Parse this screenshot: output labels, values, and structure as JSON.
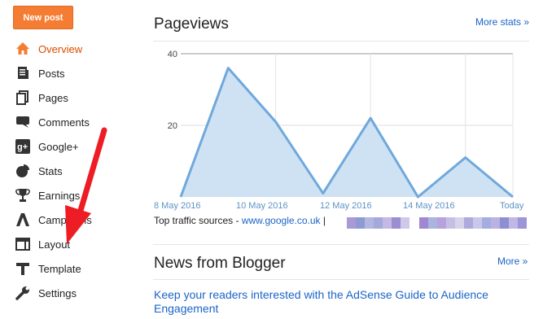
{
  "sidebar": {
    "new_post_label": "New post",
    "items": [
      {
        "label": "Overview",
        "icon": "home-icon",
        "active": true
      },
      {
        "label": "Posts",
        "icon": "posts-icon"
      },
      {
        "label": "Pages",
        "icon": "pages-icon"
      },
      {
        "label": "Comments",
        "icon": "comments-icon"
      },
      {
        "label": "Google+",
        "icon": "google-plus-icon"
      },
      {
        "label": "Stats",
        "icon": "stats-icon"
      },
      {
        "label": "Earnings",
        "icon": "trophy-icon"
      },
      {
        "label": "Campaigns",
        "icon": "campaigns-icon"
      },
      {
        "label": "Layout",
        "icon": "layout-icon"
      },
      {
        "label": "Template",
        "icon": "template-icon"
      },
      {
        "label": "Settings",
        "icon": "wrench-icon"
      }
    ]
  },
  "pageviews": {
    "title": "Pageviews",
    "more_stats_label": "More stats »"
  },
  "chart_data": {
    "type": "area",
    "x": [
      "8 May 2016",
      "9 May 2016",
      "10 May 2016",
      "11 May 2016",
      "12 May 2016",
      "13 May 2016",
      "14 May 2016",
      "15 May 2016",
      "Today"
    ],
    "x_tick_labels": [
      "8 May 2016",
      "10 May 2016",
      "12 May 2016",
      "14 May 2016",
      "Today"
    ],
    "values": [
      0,
      36,
      21,
      1,
      22,
      0,
      11,
      0
    ],
    "y_tick_labels": [
      "40",
      "20"
    ],
    "ylim": [
      0,
      40
    ],
    "grid": true,
    "line_color": "#6fa8dc",
    "fill_color": "#cfe2f3"
  },
  "traffic": {
    "label": "Top traffic sources - ",
    "source_link": "www.google.co.uk",
    "separator": "|"
  },
  "news": {
    "title": "News from Blogger",
    "more_label": "More »",
    "article_link": "Keep your readers interested with the AdSense Guide to Audience Engagement"
  },
  "colors": {
    "accent": "#f57d33",
    "link": "#1a64c8",
    "arrow": "#ee1c24"
  }
}
